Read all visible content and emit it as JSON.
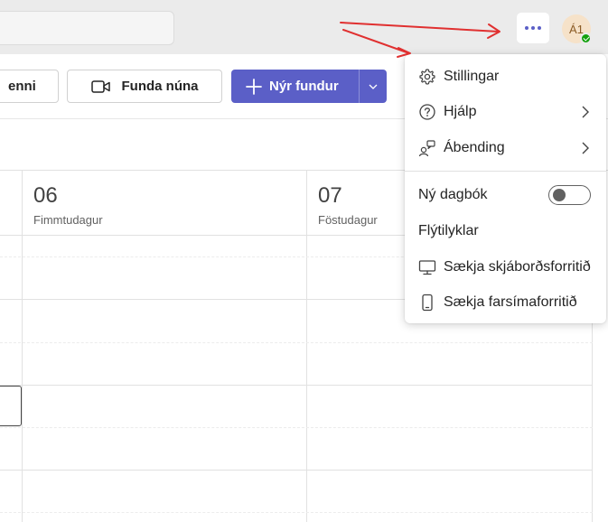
{
  "header": {
    "more_icon": "more-horizontal-icon",
    "avatar_initials": "Á1",
    "presence": "available",
    "colors": {
      "accent": "#5b5fc7",
      "presence": "#13a10e",
      "avatar_bg": "#f6e2c9"
    }
  },
  "toolbar": {
    "cut_label": "enni",
    "meet_now_label": "Funda núna",
    "new_meeting_label": "Nýr fundur"
  },
  "calendar": {
    "days": [
      {
        "number": "06",
        "name": "Fimmtudagur"
      },
      {
        "number": "07",
        "name": "Föstudagur"
      }
    ]
  },
  "menu": {
    "items": [
      {
        "label": "Stillingar",
        "icon": "gear-icon"
      },
      {
        "label": "Hjálp",
        "icon": "help-circle-icon",
        "submenu": true
      },
      {
        "label": "Ábending",
        "icon": "feedback-icon",
        "submenu": true
      },
      {
        "label": "Ný dagbók",
        "toggle": false
      },
      {
        "label": "Flýtilyklar"
      },
      {
        "label": "Sækja skjáborðsforritið",
        "icon": "desktop-icon"
      },
      {
        "label": "Sækja farsímaforritið",
        "icon": "phone-icon"
      }
    ]
  }
}
